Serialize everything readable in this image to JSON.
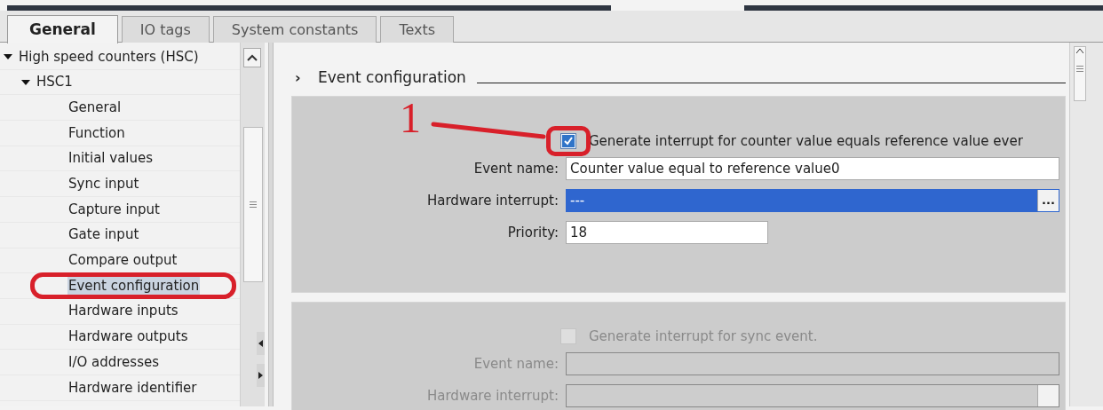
{
  "tabs": [
    {
      "label": "General",
      "selected": true
    },
    {
      "label": "IO tags",
      "selected": false
    },
    {
      "label": "System constants",
      "selected": false
    },
    {
      "label": "Texts",
      "selected": false
    }
  ],
  "tree": [
    {
      "label": "High speed counters (HSC)",
      "expanded": true,
      "selected": false,
      "children": [
        {
          "label": "HSC1",
          "expanded": true,
          "selected": false,
          "children": [
            {
              "label": "General",
              "selected": false
            },
            {
              "label": "Function",
              "selected": false
            },
            {
              "label": "Initial values",
              "selected": false
            },
            {
              "label": "Sync input",
              "selected": false
            },
            {
              "label": "Capture input",
              "selected": false
            },
            {
              "label": "Gate input",
              "selected": false
            },
            {
              "label": "Compare output",
              "selected": false
            },
            {
              "label": "Event configuration",
              "selected": true
            },
            {
              "label": "Hardware inputs",
              "selected": false
            },
            {
              "label": "Hardware outputs",
              "selected": false
            },
            {
              "label": "I/O addresses",
              "selected": false
            },
            {
              "label": "Hardware identifier",
              "selected": false
            }
          ]
        }
      ]
    }
  ],
  "section": {
    "arrow": "›",
    "title": "Event configuration"
  },
  "panels": [
    {
      "disabled": false,
      "checkbox": {
        "label": "Generate interrupt for counter value equals reference value ever",
        "checked": true
      },
      "fields": [
        {
          "kind": "text",
          "label": "Event name:",
          "value": "Counter value equal to reference value0"
        },
        {
          "kind": "picker",
          "label": "Hardware interrupt:",
          "value": "---",
          "selected": true,
          "button": "..."
        },
        {
          "kind": "short",
          "label": "Priority:",
          "value": "18"
        }
      ]
    },
    {
      "disabled": true,
      "checkbox": {
        "label": "Generate interrupt for sync event.",
        "checked": false
      },
      "fields": [
        {
          "kind": "text",
          "label": "Event name:"
        },
        {
          "kind": "picker",
          "label": "Hardware interrupt:",
          "selected": false
        }
      ]
    }
  ],
  "annotation": {
    "label": "1"
  }
}
